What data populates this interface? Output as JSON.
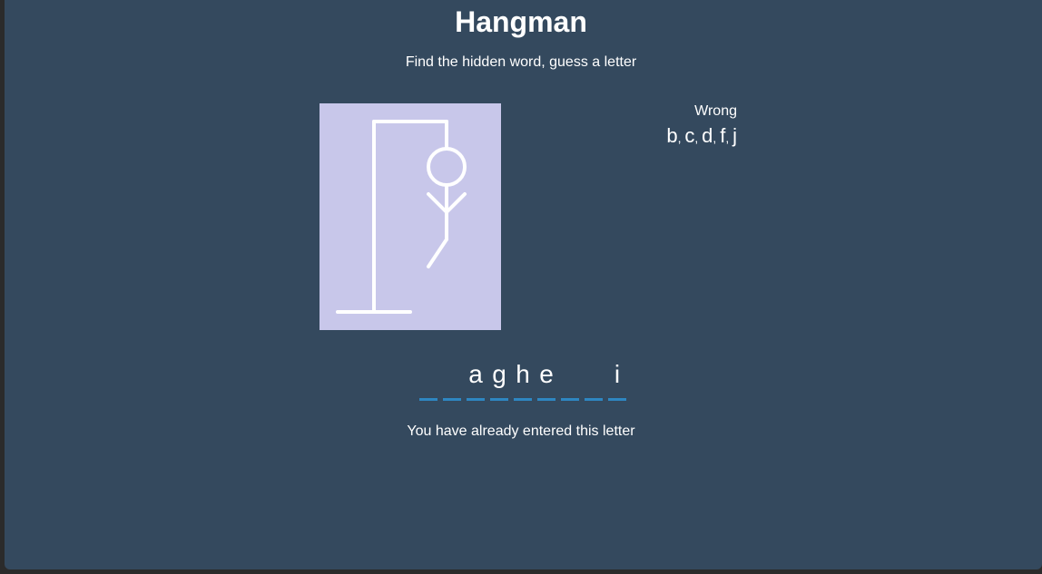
{
  "game": {
    "title": "Hangman",
    "subtitle": "Find the hidden word, guess a letter",
    "wrong_label": "Wrong",
    "wrong_letters": [
      "b",
      "c",
      "d",
      "f",
      "j"
    ],
    "word_slots": [
      "",
      "",
      "a",
      "g",
      "h",
      "e",
      "",
      "",
      "i"
    ],
    "message": "You have already entered this letter",
    "wrong_guess_count": 5
  },
  "colors": {
    "background": "#34495e",
    "gallows_bg": "#c8c7ea",
    "slot_underline": "#2e86c1",
    "text": "#ffffff"
  }
}
